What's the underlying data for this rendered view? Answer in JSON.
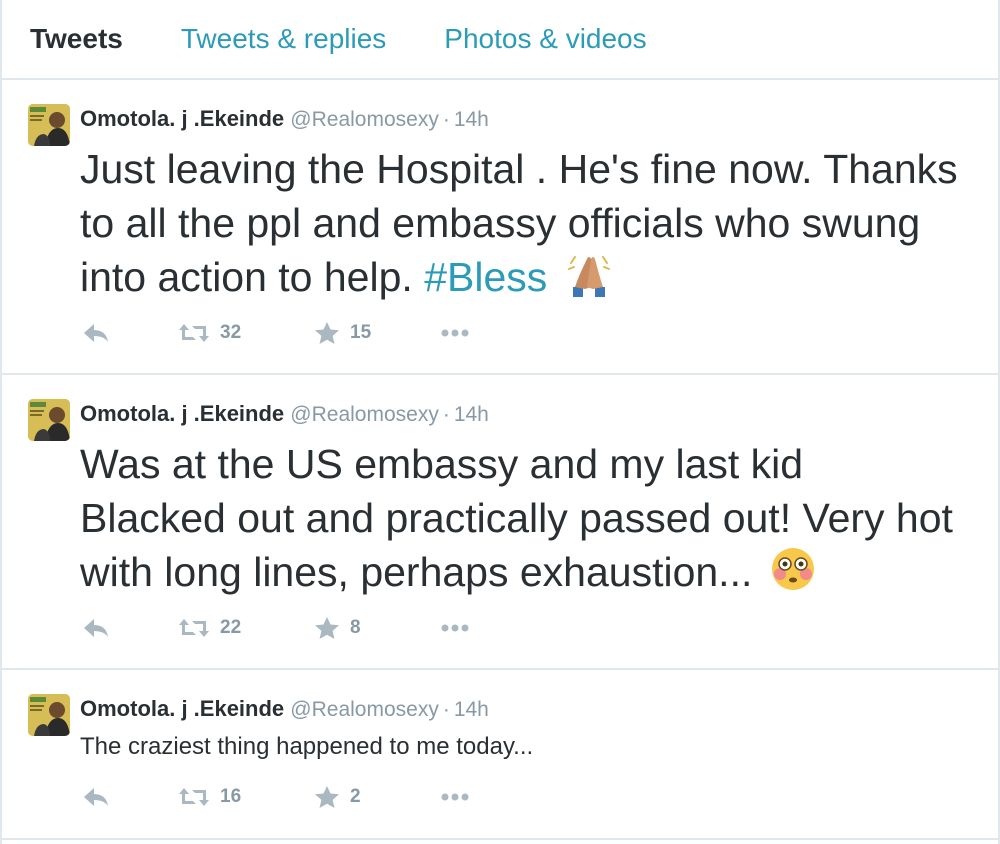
{
  "tabs": [
    {
      "label": "Tweets"
    },
    {
      "label": "Tweets & replies"
    },
    {
      "label": "Photos & videos"
    }
  ],
  "tweets": [
    {
      "name": "Omotola. j .Ekeinde",
      "handle": "@Realomosexy",
      "separator": "·",
      "time": "14h",
      "text": "Just leaving the Hospital . He's fine now. Thanks to all the ppl and embassy officials who swung into action to help.",
      "hashtag": "#Bless",
      "emoji": "folded-hands-icon",
      "retweets": "32",
      "favorites": "15"
    },
    {
      "name": "Omotola. j .Ekeinde",
      "handle": "@Realomosexy",
      "separator": "·",
      "time": "14h",
      "text": "Was at the US embassy and my last kid Blacked out and practically passed out! Very hot with long lines, perhaps exhaustion...",
      "emoji": "flushed-face-icon",
      "retweets": "22",
      "favorites": "8"
    },
    {
      "name": "Omotola. j .Ekeinde",
      "handle": "@Realomosexy",
      "separator": "·",
      "time": "14h",
      "text": "The craziest thing happened to me today...",
      "retweets": "16",
      "favorites": "2"
    }
  ],
  "colors": {
    "link": "#2b9bb8",
    "text": "#292f33",
    "meta": "#8899a6",
    "border": "#e1e8ed"
  }
}
